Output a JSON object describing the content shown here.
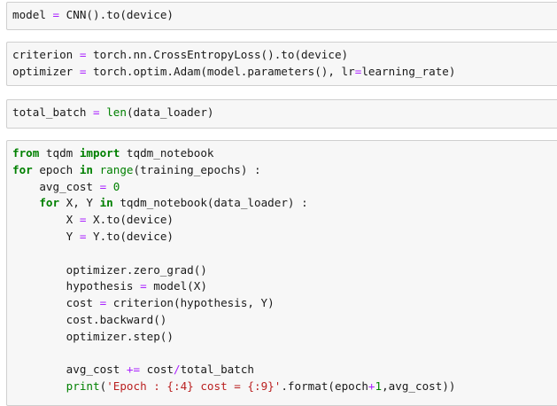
{
  "cells": [
    {
      "lines": [
        [
          {
            "t": "model ",
            "c": ""
          },
          {
            "t": "=",
            "c": "op"
          },
          {
            "t": " CNN().to(device)",
            "c": ""
          }
        ]
      ]
    },
    {
      "lines": [
        [
          {
            "t": "criterion ",
            "c": ""
          },
          {
            "t": "=",
            "c": "op"
          },
          {
            "t": " torch.nn.CrossEntropyLoss().to(device)",
            "c": ""
          }
        ],
        [
          {
            "t": "optimizer ",
            "c": ""
          },
          {
            "t": "=",
            "c": "op"
          },
          {
            "t": " torch.optim.Adam(model.parameters(), lr",
            "c": ""
          },
          {
            "t": "=",
            "c": "op"
          },
          {
            "t": "learning_rate)",
            "c": ""
          }
        ]
      ]
    },
    {
      "lines": [
        [
          {
            "t": "total_batch ",
            "c": ""
          },
          {
            "t": "=",
            "c": "op"
          },
          {
            "t": " ",
            "c": ""
          },
          {
            "t": "len",
            "c": "bi"
          },
          {
            "t": "(data_loader)",
            "c": ""
          }
        ]
      ]
    },
    {
      "lines": [
        [
          {
            "t": "from",
            "c": "kw"
          },
          {
            "t": " tqdm ",
            "c": ""
          },
          {
            "t": "import",
            "c": "kw"
          },
          {
            "t": " tqdm_notebook",
            "c": ""
          }
        ],
        [
          {
            "t": "for",
            "c": "kw"
          },
          {
            "t": " epoch ",
            "c": ""
          },
          {
            "t": "in",
            "c": "kw"
          },
          {
            "t": " ",
            "c": ""
          },
          {
            "t": "range",
            "c": "bi"
          },
          {
            "t": "(training_epochs) :",
            "c": ""
          }
        ],
        [
          {
            "t": "    avg_cost ",
            "c": ""
          },
          {
            "t": "=",
            "c": "op"
          },
          {
            "t": " ",
            "c": ""
          },
          {
            "t": "0",
            "c": "num"
          }
        ],
        [
          {
            "t": "    ",
            "c": ""
          },
          {
            "t": "for",
            "c": "kw"
          },
          {
            "t": " X, Y ",
            "c": ""
          },
          {
            "t": "in",
            "c": "kw"
          },
          {
            "t": " tqdm_notebook(data_loader) :",
            "c": ""
          }
        ],
        [
          {
            "t": "        X ",
            "c": ""
          },
          {
            "t": "=",
            "c": "op"
          },
          {
            "t": " X.to(device)",
            "c": ""
          }
        ],
        [
          {
            "t": "        Y ",
            "c": ""
          },
          {
            "t": "=",
            "c": "op"
          },
          {
            "t": " Y.to(device)",
            "c": ""
          }
        ],
        [
          {
            "t": "",
            "c": ""
          }
        ],
        [
          {
            "t": "        optimizer.zero_grad()",
            "c": ""
          }
        ],
        [
          {
            "t": "        hypothesis ",
            "c": ""
          },
          {
            "t": "=",
            "c": "op"
          },
          {
            "t": " model(X)",
            "c": ""
          }
        ],
        [
          {
            "t": "        cost ",
            "c": ""
          },
          {
            "t": "=",
            "c": "op"
          },
          {
            "t": " criterion(hypothesis, Y)",
            "c": ""
          }
        ],
        [
          {
            "t": "        cost.backward()",
            "c": ""
          }
        ],
        [
          {
            "t": "        optimizer.step()",
            "c": ""
          }
        ],
        [
          {
            "t": "",
            "c": ""
          }
        ],
        [
          {
            "t": "        avg_cost ",
            "c": ""
          },
          {
            "t": "+=",
            "c": "op"
          },
          {
            "t": " cost",
            "c": ""
          },
          {
            "t": "/",
            "c": "op"
          },
          {
            "t": "total_batch",
            "c": ""
          }
        ],
        [
          {
            "t": "        ",
            "c": ""
          },
          {
            "t": "print",
            "c": "bi"
          },
          {
            "t": "(",
            "c": ""
          },
          {
            "t": "'Epoch : {:4} cost = {:9}'",
            "c": "str"
          },
          {
            "t": ".format(epoch",
            "c": ""
          },
          {
            "t": "+",
            "c": "op"
          },
          {
            "t": "1",
            "c": "num"
          },
          {
            "t": ",avg_cost))",
            "c": ""
          }
        ]
      ]
    }
  ]
}
